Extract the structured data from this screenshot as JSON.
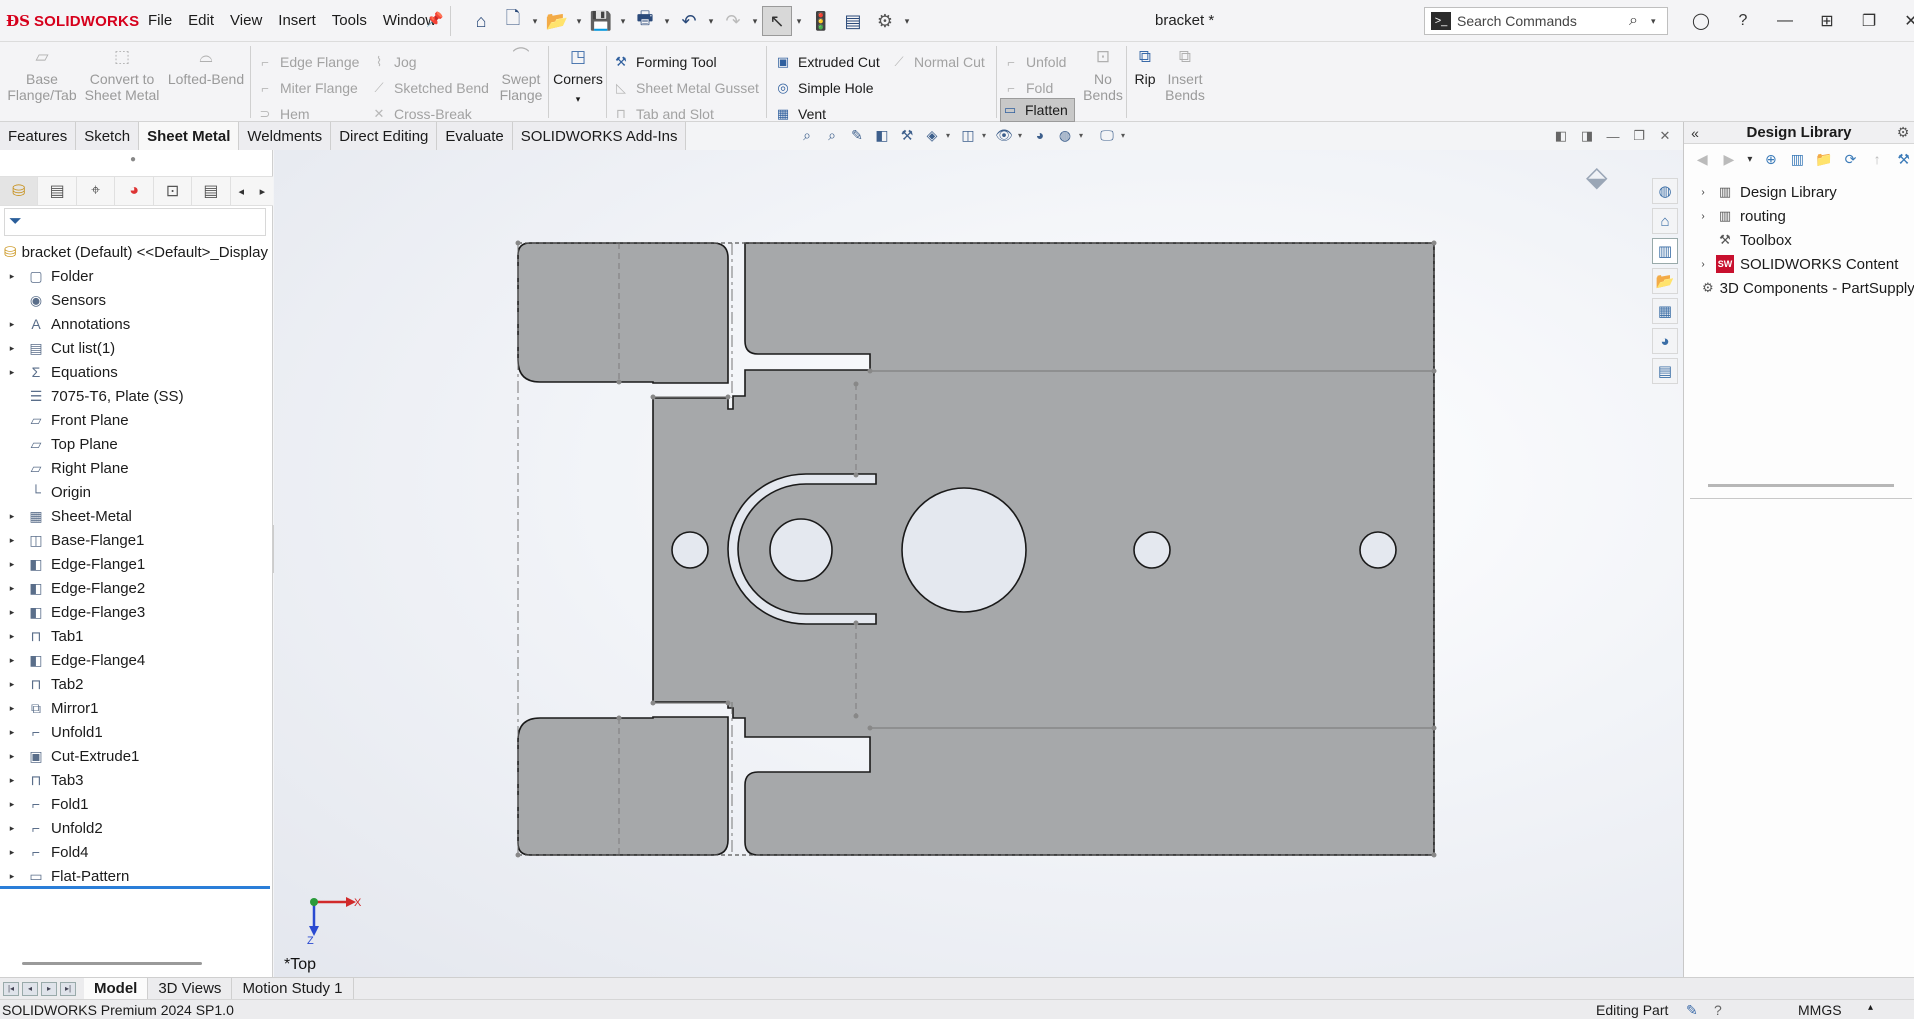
{
  "app": {
    "brand": "SOLIDWORKS",
    "brand_color": "#d6001c",
    "document_title": "bracket *"
  },
  "menu": [
    "File",
    "Edit",
    "View",
    "Insert",
    "Tools",
    "Window"
  ],
  "search": {
    "placeholder": "Search Commands"
  },
  "command_manager": {
    "base_flange": "Base\nFlange/Tab",
    "convert": "Convert to\nSheet Metal",
    "lofted": "Lofted-Bend",
    "edge_flange": "Edge Flange",
    "miter_flange": "Miter Flange",
    "hem": "Hem",
    "jog": "Jog",
    "sketched_bend": "Sketched Bend",
    "cross_break": "Cross-Break",
    "swept_flange": "Swept\nFlange",
    "corners": "Corners",
    "forming_tool": "Forming Tool",
    "gusset": "Sheet Metal Gusset",
    "tab_slot": "Tab and Slot",
    "extruded_cut": "Extruded Cut",
    "simple_hole": "Simple Hole",
    "vent": "Vent",
    "normal_cut": "Normal Cut",
    "unfold": "Unfold",
    "fold": "Fold",
    "flatten": "Flatten",
    "no_bends": "No\nBends",
    "rip": "Rip",
    "insert_bends": "Insert\nBends"
  },
  "tabs": [
    {
      "label": "Features",
      "active": false
    },
    {
      "label": "Sketch",
      "active": false
    },
    {
      "label": "Sheet Metal",
      "active": true
    },
    {
      "label": "Weldments",
      "active": false
    },
    {
      "label": "Direct Editing",
      "active": false
    },
    {
      "label": "Evaluate",
      "active": false
    },
    {
      "label": "SOLIDWORKS Add-Ins",
      "active": false
    }
  ],
  "feature_tree": {
    "root": "bracket (Default) <<Default>_Display State 1>",
    "items": [
      {
        "label": "Folder",
        "expandable": true,
        "icon": "folder-icon"
      },
      {
        "label": "Sensors",
        "expandable": false,
        "icon": "sensor-icon"
      },
      {
        "label": "Annotations",
        "expandable": true,
        "icon": "annotation-icon"
      },
      {
        "label": "Cut list(1)",
        "expandable": true,
        "icon": "cutlist-icon"
      },
      {
        "label": "Equations",
        "expandable": true,
        "icon": "equation-icon"
      },
      {
        "label": "7075-T6, Plate (SS)",
        "expandable": false,
        "icon": "material-icon"
      },
      {
        "label": "Front Plane",
        "expandable": false,
        "icon": "plane-icon"
      },
      {
        "label": "Top Plane",
        "expandable": false,
        "icon": "plane-icon"
      },
      {
        "label": "Right Plane",
        "expandable": false,
        "icon": "plane-icon"
      },
      {
        "label": "Origin",
        "expandable": false,
        "icon": "origin-icon"
      },
      {
        "label": "Sheet-Metal",
        "expandable": true,
        "icon": "sheetmetal-icon"
      },
      {
        "label": "Base-Flange1",
        "expandable": true,
        "icon": "baseflange-icon"
      },
      {
        "label": "Edge-Flange1",
        "expandable": true,
        "icon": "edgeflange-icon"
      },
      {
        "label": "Edge-Flange2",
        "expandable": true,
        "icon": "edgeflange-icon"
      },
      {
        "label": "Edge-Flange3",
        "expandable": true,
        "icon": "edgeflange-icon"
      },
      {
        "label": "Tab1",
        "expandable": true,
        "icon": "tab-icon"
      },
      {
        "label": "Edge-Flange4",
        "expandable": true,
        "icon": "edgeflange-icon"
      },
      {
        "label": "Tab2",
        "expandable": true,
        "icon": "tab-icon"
      },
      {
        "label": "Mirror1",
        "expandable": true,
        "icon": "mirror-icon"
      },
      {
        "label": "Unfold1",
        "expandable": true,
        "icon": "unfold-icon"
      },
      {
        "label": "Cut-Extrude1",
        "expandable": true,
        "icon": "cutextrude-icon"
      },
      {
        "label": "Tab3",
        "expandable": true,
        "icon": "tab-icon"
      },
      {
        "label": "Fold1",
        "expandable": true,
        "icon": "fold-icon"
      },
      {
        "label": "Unfold2",
        "expandable": true,
        "icon": "unfold-icon"
      },
      {
        "label": "Fold4",
        "expandable": true,
        "icon": "fold-icon"
      },
      {
        "label": "Flat-Pattern",
        "expandable": true,
        "icon": "flatpattern-icon"
      }
    ]
  },
  "viewport": {
    "view_name": "*Top",
    "triad_x": "X",
    "triad_z": "Z",
    "part_color": "#a6a8aa"
  },
  "design_library": {
    "title": "Design Library",
    "items": [
      {
        "label": "Design Library",
        "expandable": true,
        "icon": "library-icon"
      },
      {
        "label": "routing",
        "expandable": true,
        "icon": "library-icon"
      },
      {
        "label": "Toolbox",
        "expandable": false,
        "icon": "toolbox-icon"
      },
      {
        "label": "SOLIDWORKS Content",
        "expandable": true,
        "icon": "sw-content-icon"
      },
      {
        "label": "3D Components - PartSupply",
        "expandable": false,
        "icon": "components-icon"
      }
    ]
  },
  "bottom_tabs": [
    {
      "label": "Model",
      "active": true
    },
    {
      "label": "3D Views",
      "active": false
    },
    {
      "label": "Motion Study 1",
      "active": false
    }
  ],
  "status": {
    "product": "SOLIDWORKS Premium 2024 SP1.0",
    "mode": "Editing Part",
    "units": "MMGS"
  }
}
